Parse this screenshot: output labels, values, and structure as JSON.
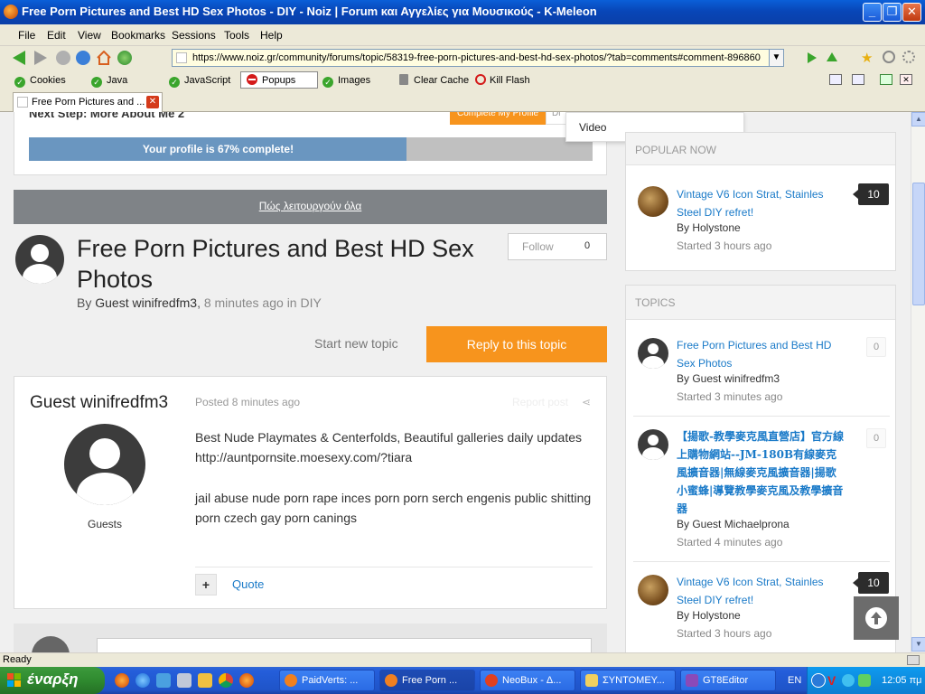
{
  "window": {
    "title": "Free Porn Pictures and Best HD Sex Photos - DIY - Noiz | Forum και Αγγελίες για Μουσικούς - K-Meleon"
  },
  "menu": [
    "File",
    "Edit",
    "View",
    "Bookmarks",
    "Sessions",
    "Tools",
    "Help"
  ],
  "url": "https://www.noiz.gr/community/forums/topic/58319-free-porn-pictures-and-best-hd-sex-photos/?tab=comments#comment-896860",
  "toolbar2": {
    "cookies": "Cookies",
    "java": "Java",
    "javascript": "JavaScript",
    "popups": "Popups",
    "images": "Images",
    "clear_cache": "Clear Cache",
    "kill_flash": "Kill Flash"
  },
  "tab": {
    "label": "Free Porn Pictures and ..."
  },
  "page": {
    "next_step": "Next Step: More About Me 2",
    "complete_profile_button": "Complete My Profile",
    "dismiss_partial": "Di",
    "dropdown_item": "Video",
    "profile_progress_text": "Your profile is 67% complete!",
    "profile_progress": 0.67,
    "how_it_works": "Πώς λειτουργούν όλα",
    "topic_title": "Free Porn Pictures and Best HD Sex Photos",
    "by_prefix": "By",
    "topic_author": "Guest winifredfm3",
    "topic_time": "8 minutes ago",
    "in_text": "in",
    "topic_forum": "DIY",
    "follow_label": "Follow",
    "follow_count": "0",
    "start_new_topic": "Start new topic",
    "reply_button": "Reply to this topic",
    "post": {
      "author": "Guest winifredfm3",
      "posted": "Posted 8 minutes ago",
      "report": "Report post",
      "group": "Guests",
      "line1": "Best Nude Playmates & Centerfolds, Beautiful galleries daily updates",
      "line2": "http://auntpornsite.moesexy.com/?tiara",
      "line3": "jail abuse nude porn rape inces porn porn serch engenis public shitting porn czech gay porn canings",
      "quote": "Quote",
      "plus": "+"
    }
  },
  "sidebar": {
    "popular_header": "POPULAR NOW",
    "popular": [
      {
        "title": "Vintage V6 Icon Strat, Stainles Steel DIY refret!",
        "by": "By Holystone",
        "started": "Started 3 hours ago",
        "count": "10"
      }
    ],
    "topics_header": "TOPICS",
    "topics": [
      {
        "title": "Free Porn Pictures and Best HD Sex Photos",
        "by": "By Guest winifredfm3",
        "started": "Started 3 minutes ago",
        "count": "0"
      },
      {
        "title": "【揚歌-教學麥克風直營店】官方線上購物網站--JM-180B有線麥克風擴音器|無線麥克風擴音器|揚歌小蜜蜂|導覽教學麥克風及教學擴音器",
        "by": "By Guest Michaelprona",
        "started": "Started 4 minutes ago",
        "count": "0"
      },
      {
        "title": "Vintage V6 Icon Strat, Stainles Steel DIY refret!",
        "by": "By Holystone",
        "started": "Started 3 hours ago",
        "count": "10"
      }
    ]
  },
  "status": {
    "text": "Ready"
  },
  "taskbar": {
    "start": "έναρξη",
    "buttons": [
      "PaidVerts: ...",
      "Free Porn ...",
      "NeoBux - Δ...",
      "ΣΥΝΤΟΜΕΥ...",
      "GT8Editor"
    ],
    "lang": "EN",
    "clock": "12:05 πμ"
  }
}
